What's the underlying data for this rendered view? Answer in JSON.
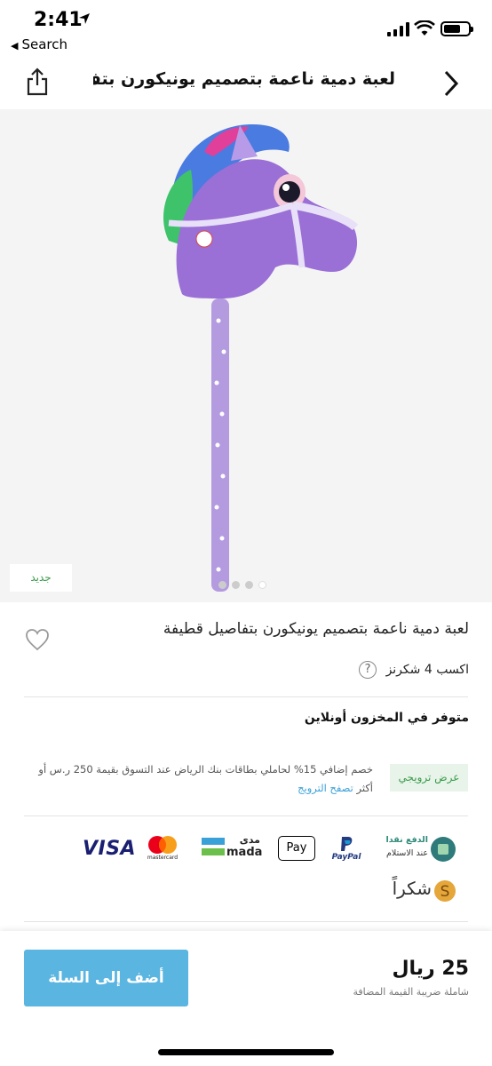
{
  "status": {
    "time": "2:41"
  },
  "nav": {
    "back_label": "Search"
  },
  "header": {
    "title": "لعبة دمية ناعمة بتصميم يونيكورن بتف..."
  },
  "image": {
    "badge": "جديد",
    "slide_count": 4,
    "active_slide": 3
  },
  "product": {
    "title": "لعبة دمية ناعمة بتصميم يونيكورن بتفاصيل قطيفة",
    "points": "اكسب 4 شكرنز",
    "points_help": "?",
    "stock": "متوفر في المخزون أونلاين"
  },
  "promo": {
    "tag": "عرض ترويجي",
    "text": "خصم إضافي 15% لحاملي بطاقات بنك الرياض عند التسوق بقيمة 250 ر.س أو أكثر",
    "link": "تصفح الترويج"
  },
  "payments": {
    "cod_line1": "الدفع نقدا",
    "cod_line2": "عند الاستلام",
    "paypal": "PayPal",
    "apple_pay": "Pay",
    "mada_ar": "مدى",
    "mada_en": "mada",
    "mastercard": "mastercard",
    "visa": "VISA",
    "shukran": "شكراً"
  },
  "footer": {
    "price": "25 ريال",
    "vat": "شاملة ضريبة القيمة المضافة",
    "add_to_cart": "أضف إلى السلة"
  }
}
